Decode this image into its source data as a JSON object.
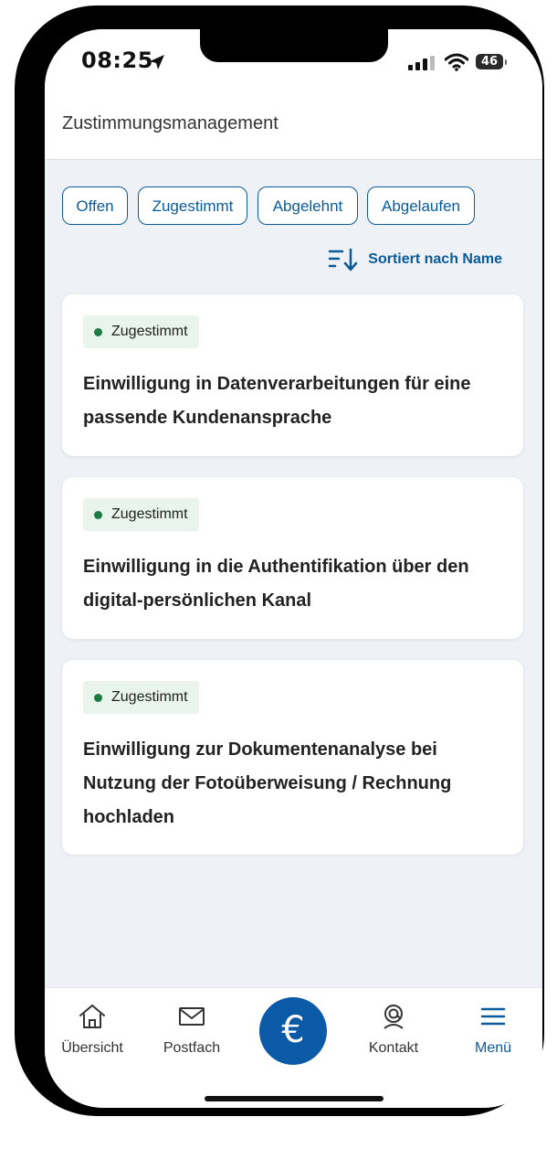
{
  "status_bar": {
    "time": "08:25",
    "battery": "46"
  },
  "header": {
    "title": "Zustimmungsmanagement"
  },
  "filters": [
    "Offen",
    "Zugestimmt",
    "Abgelehnt",
    "Abgelaufen"
  ],
  "sort": {
    "label": "Sortiert nach Name"
  },
  "cards": [
    {
      "status": "Zugestimmt",
      "title": "Einwilligung in Datenverarbeitungen für eine passende Kundenansprache"
    },
    {
      "status": "Zugestimmt",
      "title": "Einwilligung in die Authentifikation über den digital-persönlichen Kanal"
    },
    {
      "status": "Zugestimmt",
      "title": "Einwilligung zur Dokumentenanalyse bei Nutzung der Fotoüberweisung / Rechnung hochladen"
    }
  ],
  "tabbar": {
    "items": [
      {
        "label": "Übersicht",
        "icon": "home-icon"
      },
      {
        "label": "Postfach",
        "icon": "mail-icon"
      },
      {
        "label": "",
        "icon": "euro-icon",
        "symbol": "€"
      },
      {
        "label": "Kontakt",
        "icon": "contact-icon"
      },
      {
        "label": "Menü",
        "icon": "menu-icon"
      }
    ]
  },
  "colors": {
    "accent": "#0b5a9a",
    "status_green": "#1e7a40",
    "badge_bg": "#e8f4ec",
    "background": "#eef1f5"
  }
}
